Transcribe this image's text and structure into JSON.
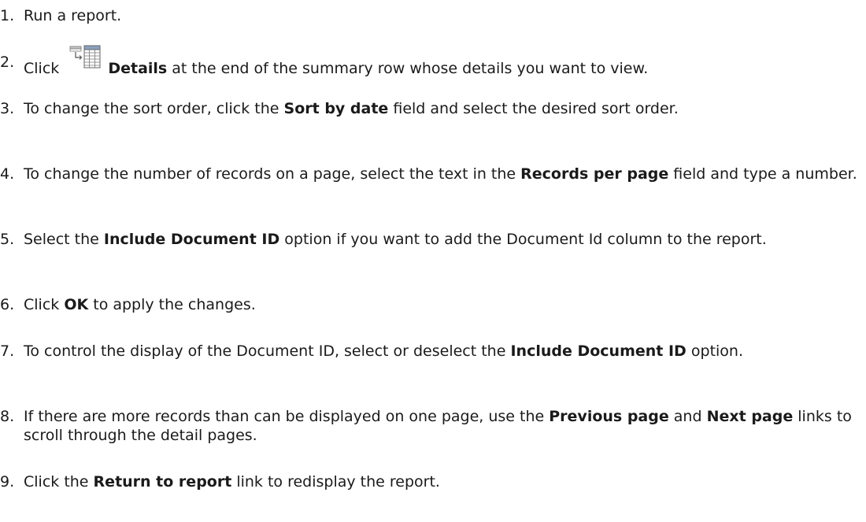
{
  "steps": [
    {
      "num": "1.",
      "parts": [
        "Run a report."
      ]
    },
    {
      "num": "2.",
      "parts": [
        "Click ",
        "Details",
        " at the end of the summary row whose details you want to view."
      ],
      "icon": "details-icon"
    },
    {
      "num": "3.",
      "parts": [
        "To change the sort order, click the ",
        "Sort by date",
        " field and select the desired sort order."
      ]
    },
    {
      "num": "4.",
      "parts": [
        "To change the number of records on a page, select the text in the ",
        "Records per page",
        " field and type a number."
      ]
    },
    {
      "num": "5.",
      "parts": [
        "Select the ",
        "Include Document ID",
        " option if you want to add the Document Id column to the report."
      ]
    },
    {
      "num": "6.",
      "parts": [
        "Click ",
        "OK",
        " to apply the changes."
      ]
    },
    {
      "num": "7.",
      "parts": [
        "To control the display of the Document ID, select or deselect the ",
        "Include Document ID",
        " option."
      ]
    },
    {
      "num": "8.",
      "parts": [
        "If there are more records than can be displayed on one page, use the ",
        "Previous page",
        " and ",
        "Next page",
        " links to scroll through the detail pages."
      ]
    },
    {
      "num": "9.",
      "parts": [
        "Click the ",
        "Return to report",
        " link to redisplay the report."
      ]
    }
  ]
}
